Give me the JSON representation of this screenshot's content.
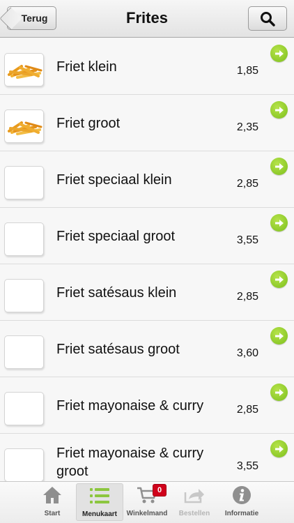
{
  "header": {
    "back_label": "Terug",
    "title": "Frites"
  },
  "items": [
    {
      "name": "Friet klein",
      "price": "1,85",
      "has_image": true
    },
    {
      "name": "Friet groot",
      "price": "2,35",
      "has_image": true
    },
    {
      "name": "Friet speciaal klein",
      "price": "2,85",
      "has_image": false
    },
    {
      "name": "Friet speciaal groot",
      "price": "3,55",
      "has_image": false
    },
    {
      "name": "Friet satésaus klein",
      "price": "2,85",
      "has_image": false
    },
    {
      "name": "Friet satésaus groot",
      "price": "3,60",
      "has_image": false
    },
    {
      "name": "Friet mayonaise & curry",
      "price": "2,85",
      "has_image": false
    },
    {
      "name": "Friet mayonaise & curry groot",
      "price": "3,55",
      "has_image": false
    }
  ],
  "tabbar": {
    "tabs": [
      {
        "label": "Start",
        "icon": "home-icon"
      },
      {
        "label": "Menukaart",
        "icon": "menu-list-icon",
        "active": true
      },
      {
        "label": "Winkelmand",
        "icon": "cart-icon",
        "badge": "0"
      },
      {
        "label": "Bestellen",
        "icon": "share-icon",
        "disabled": true
      },
      {
        "label": "Informatie",
        "icon": "info-icon"
      }
    ]
  },
  "colors": {
    "accent_green": "#8cc63f",
    "badge_red": "#d0021b"
  }
}
